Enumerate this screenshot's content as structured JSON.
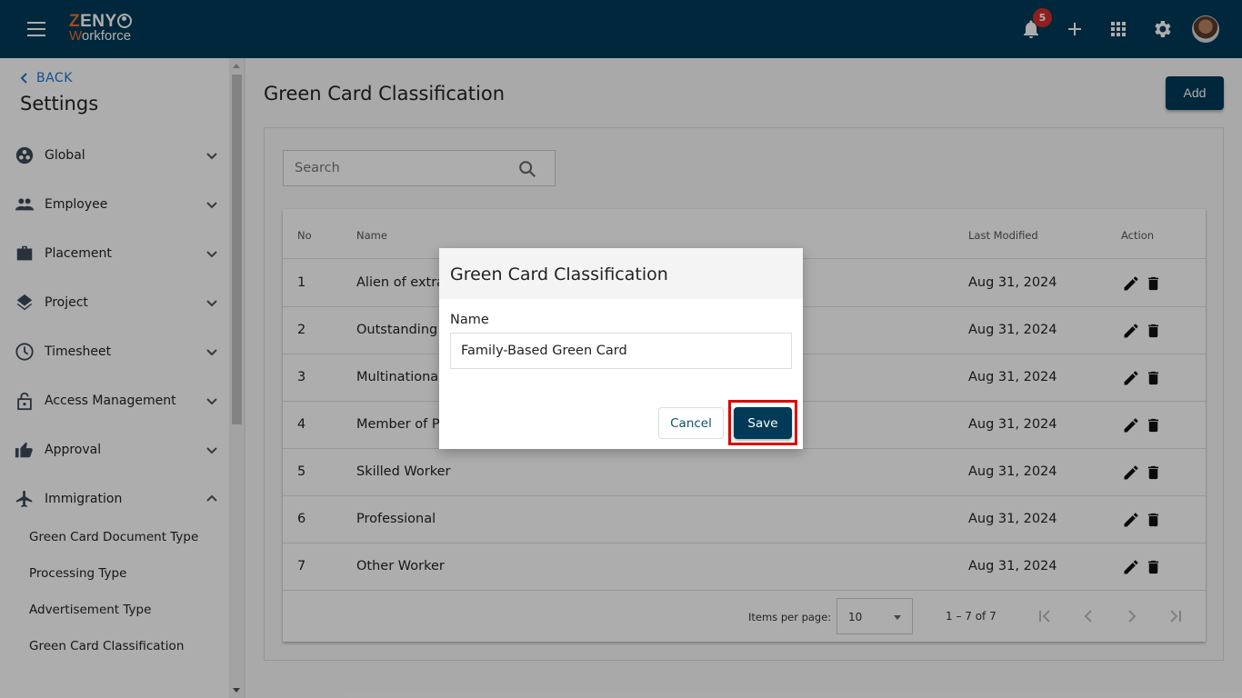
{
  "app": {
    "logo_line1": "ZENY",
    "logo_line2": "Workforce",
    "notification_count": "5",
    "icons": [
      "menu-icon",
      "bell-icon",
      "plus-icon",
      "apps-grid-icon",
      "gear-icon",
      "avatar"
    ]
  },
  "sidebar": {
    "back_label": "BACK",
    "title": "Settings",
    "items": [
      {
        "label": "Global",
        "icon": "global-icon",
        "expanded": false
      },
      {
        "label": "Employee",
        "icon": "people-icon",
        "expanded": false
      },
      {
        "label": "Placement",
        "icon": "briefcase-icon",
        "expanded": false
      },
      {
        "label": "Project",
        "icon": "layers-icon",
        "expanded": false
      },
      {
        "label": "Timesheet",
        "icon": "clock-icon",
        "expanded": false
      },
      {
        "label": "Access Management",
        "icon": "lock-icon",
        "expanded": false
      },
      {
        "label": "Approval",
        "icon": "thumbs-up-icon",
        "expanded": false
      },
      {
        "label": "Immigration",
        "icon": "airplane-icon",
        "expanded": true
      }
    ],
    "sub_items": [
      {
        "label": "Green Card Document Type"
      },
      {
        "label": "Processing Type"
      },
      {
        "label": "Advertisement Type"
      },
      {
        "label": "Green Card Classification"
      }
    ]
  },
  "main": {
    "title": "Green Card Classification",
    "add_label": "Add",
    "search_placeholder": "Search",
    "table": {
      "columns": [
        "No",
        "Name",
        "Last Modified",
        "Action"
      ],
      "rows": [
        {
          "no": "1",
          "name": "Alien of extra",
          "modified": "Aug 31, 2024"
        },
        {
          "no": "2",
          "name": "Outstanding",
          "modified": "Aug 31, 2024"
        },
        {
          "no": "3",
          "name": "Multinational",
          "modified": "Aug 31, 2024"
        },
        {
          "no": "4",
          "name": "Member of P",
          "modified": "Aug 31, 2024"
        },
        {
          "no": "5",
          "name": "Skilled Worker",
          "modified": "Aug 31, 2024"
        },
        {
          "no": "6",
          "name": "Professional",
          "modified": "Aug 31, 2024"
        },
        {
          "no": "7",
          "name": "Other Worker",
          "modified": "Aug 31, 2024"
        }
      ]
    },
    "paginator": {
      "items_per_page_label": "Items per page:",
      "items_per_page_value": "10",
      "range_label": "1 – 7 of 7"
    }
  },
  "modal": {
    "title": "Green Card Classification",
    "field_label": "Name",
    "field_value": "Family-Based Green Card",
    "cancel_label": "Cancel",
    "save_label": "Save"
  },
  "colors": {
    "primary": "#003a57",
    "badge": "#d32f2f",
    "highlight": "#e00000",
    "logo_accent": "#e8702a"
  }
}
